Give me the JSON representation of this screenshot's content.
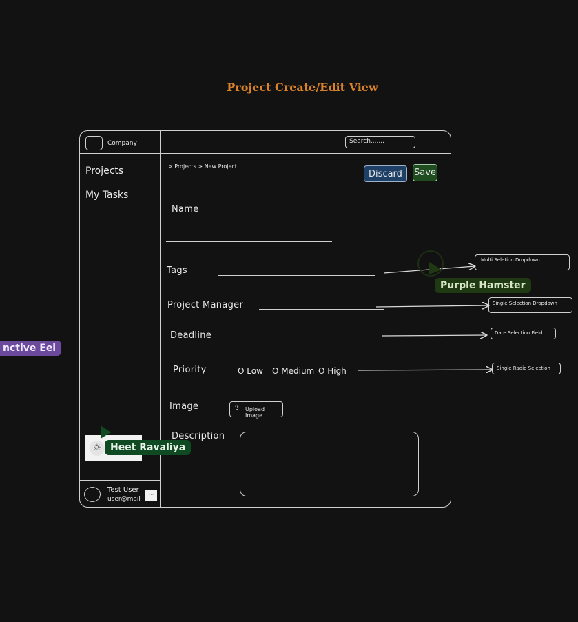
{
  "title": "Project Create/Edit  View",
  "sidebar": {
    "company": "Company",
    "items": [
      {
        "label": "Projects"
      },
      {
        "label": "My Tasks"
      }
    ],
    "user": {
      "name": "Test User",
      "email": "user@mail",
      "more": "···"
    }
  },
  "header": {
    "search_placeholder": "Search......."
  },
  "breadcrumb": "> Projects > New Project",
  "actions": {
    "discard": "Discard",
    "save": "Save"
  },
  "form": {
    "name_label": "Name",
    "tags_label": "Tags",
    "pm_label": "Project Manager",
    "deadline_label": "Deadline",
    "priority_label": "Priority",
    "priority_options": [
      "O Low",
      "O Medium",
      "O High"
    ],
    "image_label": "Image",
    "upload_label": "Upload Image",
    "description_label": "Description"
  },
  "annotations": {
    "tags": "Multi Seletion Dropdown",
    "pm": "Single Selection Dropdown",
    "deadline": "Date Selection Field",
    "priority": "Single Radio Selection"
  },
  "cursors": [
    {
      "name": "Purple Hamster",
      "color": "#1f3a12"
    },
    {
      "name": "Heet Ravaliya",
      "color": "#0f4a22"
    },
    {
      "name": "nctive Eel",
      "color": "#6b4a9e"
    }
  ],
  "colors": {
    "background": "#121212",
    "title": "#d9822b",
    "discard_bg": "#1e3f66",
    "save_bg": "#1f4d1f"
  }
}
